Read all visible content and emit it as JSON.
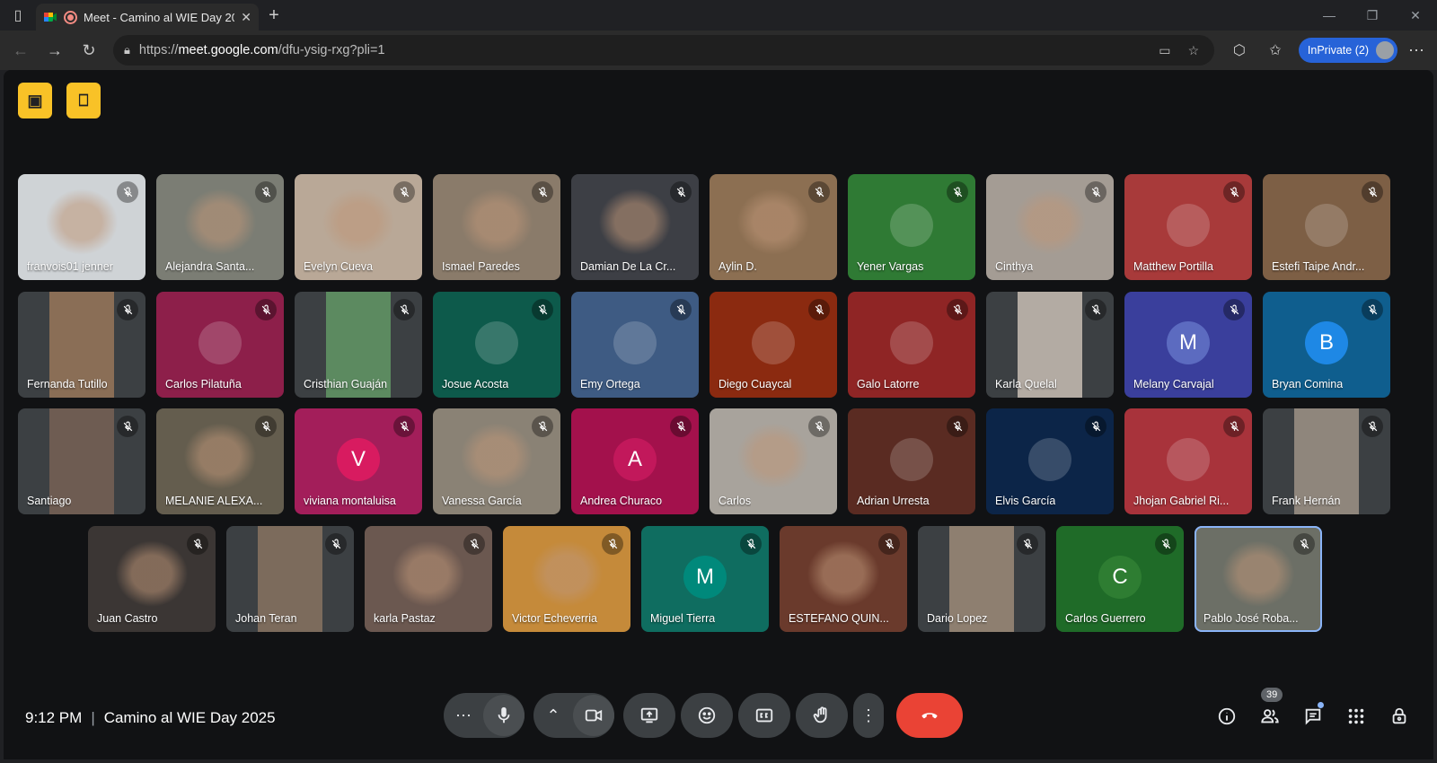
{
  "browser": {
    "tab_title": "Meet - Camino al WIE Day 20",
    "url_prefix": "https://",
    "url_host": "meet.google.com",
    "url_path": "/dfu-ysig-rxg?pli=1",
    "inprivate_label": "InPrivate (2)",
    "icons": [
      "sidebar-icon",
      "meet-logo-icon",
      "recording-icon",
      "close-icon",
      "plus-icon",
      "minimize-icon",
      "maximize-icon",
      "window-close-icon",
      "back-icon",
      "forward-icon",
      "reload-icon",
      "lock-icon",
      "camera-blocked-icon",
      "star-icon",
      "extensions-icon",
      "favorites-icon",
      "more-icon"
    ]
  },
  "meeting": {
    "time": "9:12 PM",
    "separator": "|",
    "title": "Camino al WIE Day 2025",
    "people_count": "39",
    "colors": {
      "accent": "#8ab4f8",
      "end_call": "#ea4335",
      "corner_buttons": "#f9c227"
    }
  },
  "participants": [
    {
      "name": "franvois01 jenner",
      "bg": "#cfd3d6",
      "kind": "video"
    },
    {
      "name": "Alejandra Santa...",
      "bg": "#7b7d74",
      "kind": "video"
    },
    {
      "name": "Evelyn Cueva",
      "bg": "#b9a897",
      "kind": "video"
    },
    {
      "name": "Ismael Paredes",
      "bg": "#8a7b6a",
      "kind": "video"
    },
    {
      "name": "Damian De La Cr...",
      "bg": "#3d3f45",
      "kind": "video"
    },
    {
      "name": "Aylin D.",
      "bg": "#8c6f52",
      "kind": "video"
    },
    {
      "name": "Yener Vargas",
      "bg": "#2f7a34",
      "kind": "image"
    },
    {
      "name": "Cinthya",
      "bg": "#a49c94",
      "kind": "video"
    },
    {
      "name": "Matthew Portilla",
      "bg": "#a83a3a",
      "kind": "image"
    },
    {
      "name": "Estefi Taipe Andr...",
      "bg": "#7d5f45",
      "kind": "image"
    },
    {
      "name": "Fernanda Tutillo",
      "bg": "#3c4043",
      "kind": "narrow",
      "inner": "#8a6e56"
    },
    {
      "name": "Carlos Pilatuña",
      "bg": "#8d1f4a",
      "kind": "image"
    },
    {
      "name": "Cristhian Guaján",
      "bg": "#3c4043",
      "kind": "narrow",
      "inner": "#5c8a60"
    },
    {
      "name": "Josue Acosta",
      "bg": "#0d5a4b",
      "kind": "image"
    },
    {
      "name": "Emy Ortega",
      "bg": "#3e5b83",
      "kind": "image"
    },
    {
      "name": "Diego Cuaycal",
      "bg": "#8b2a10",
      "kind": "image"
    },
    {
      "name": "Galo Latorre",
      "bg": "#8f2525",
      "kind": "image"
    },
    {
      "name": "Karla Quelal",
      "bg": "#3c4043",
      "kind": "narrow",
      "inner": "#b3aba3"
    },
    {
      "name": "Melany Carvajal",
      "bg": "#3a3f9c",
      "kind": "letter",
      "letter": "M",
      "avatar": "#5c6bc0"
    },
    {
      "name": "Bryan Comina",
      "bg": "#0f5e8e",
      "kind": "letter",
      "letter": "B",
      "avatar": "#1e88e5"
    },
    {
      "name": "Santiago",
      "bg": "#3c4043",
      "kind": "narrow",
      "inner": "#6e5c52"
    },
    {
      "name": "MELANIE ALEXA...",
      "bg": "#645d4e",
      "kind": "video"
    },
    {
      "name": "viviana montaluisa",
      "bg": "#a31e5a",
      "kind": "letter",
      "letter": "V",
      "avatar": "#d81b60"
    },
    {
      "name": "Vanessa García",
      "bg": "#8a8275",
      "kind": "video"
    },
    {
      "name": "Andrea Churaco",
      "bg": "#a3114c",
      "kind": "letter",
      "letter": "A",
      "avatar": "#c2185b"
    },
    {
      "name": "Carlos",
      "bg": "#a8a39c",
      "kind": "video"
    },
    {
      "name": "Adrian Urresta",
      "bg": "#5a2b22",
      "kind": "image"
    },
    {
      "name": "Elvis García",
      "bg": "#0c2548",
      "kind": "image"
    },
    {
      "name": "Jhojan Gabriel Ri...",
      "bg": "#a8333b",
      "kind": "image"
    },
    {
      "name": "Frank Hernán",
      "bg": "#3c4043",
      "kind": "narrow",
      "inner": "#8f867c"
    },
    {
      "name": "Juan Castro",
      "bg": "#3b3634",
      "kind": "video"
    },
    {
      "name": "Johan Teran",
      "bg": "#3c4043",
      "kind": "narrow",
      "inner": "#7c6b5c"
    },
    {
      "name": "karla Pastaz",
      "bg": "#6b5850",
      "kind": "video"
    },
    {
      "name": "Victor Echeverria",
      "bg": "#c58a3a",
      "kind": "video"
    },
    {
      "name": "Miguel Tierra",
      "bg": "#0f6d60",
      "kind": "letter",
      "letter": "M",
      "avatar": "#00897b"
    },
    {
      "name": "ESTEFANO QUIN...",
      "bg": "#6a3a2c",
      "kind": "video"
    },
    {
      "name": "Dario Lopez",
      "bg": "#3c4043",
      "kind": "narrow",
      "inner": "#8e7f70"
    },
    {
      "name": "Carlos Guerrero",
      "bg": "#1f6b28",
      "kind": "letter",
      "letter": "C",
      "avatar": "#2e7d32"
    },
    {
      "name": "Pablo José Roba...",
      "bg": "#6c6f66",
      "kind": "video",
      "active": true
    }
  ]
}
